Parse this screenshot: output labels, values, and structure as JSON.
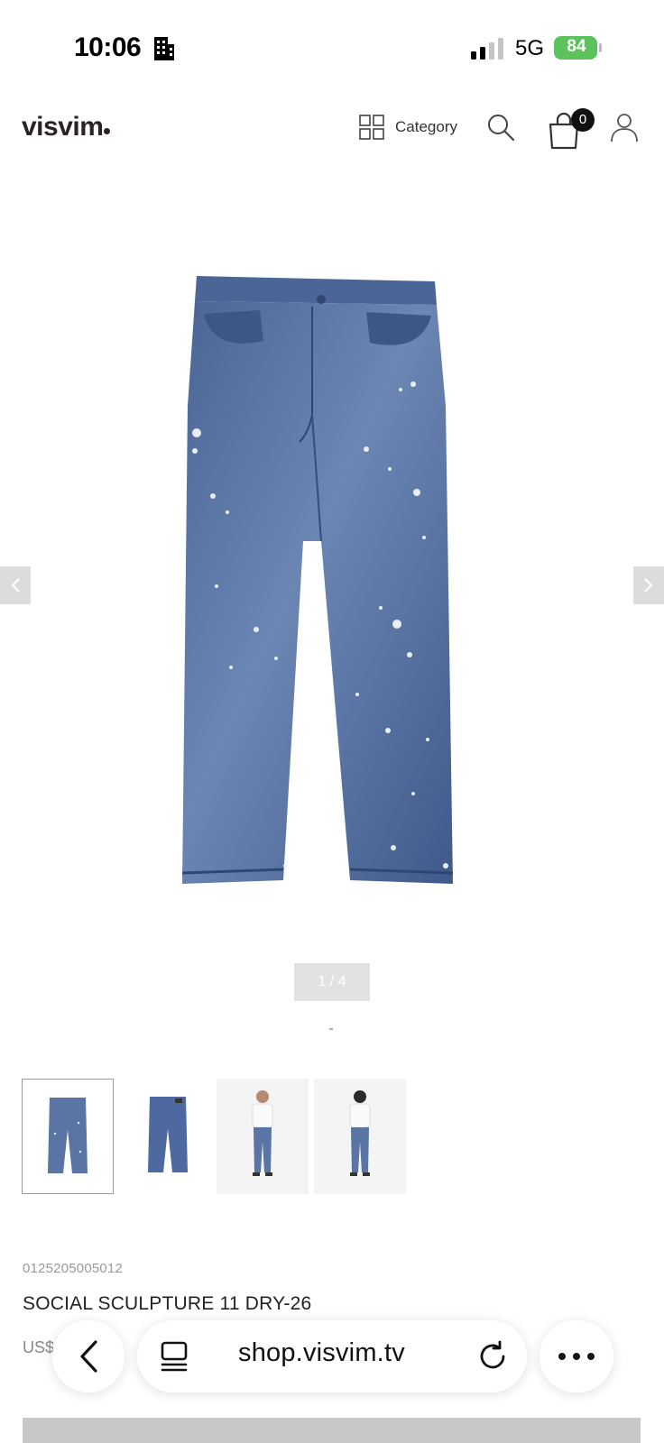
{
  "status_bar": {
    "time": "10:06",
    "network": "5G",
    "battery": "84",
    "battery_color": "#5cc25c"
  },
  "header": {
    "logo": "visvim",
    "category_label": "Category",
    "cart_count": "0",
    "icons": [
      "grid-icon",
      "search-icon",
      "shopping-bag-icon",
      "user-icon"
    ]
  },
  "gallery": {
    "pager": "1 / 4",
    "thumbnails": [
      {
        "name": "jeans-front",
        "selected": true
      },
      {
        "name": "jeans-back",
        "selected": false
      },
      {
        "name": "model-front",
        "selected": false
      },
      {
        "name": "model-back",
        "selected": false
      }
    ]
  },
  "product": {
    "sku": "0125205005012",
    "name": "SOCIAL SCULPTURE 11 DRY-26",
    "price_visible": "US$"
  },
  "browser": {
    "url": "shop.visvim.tv"
  }
}
